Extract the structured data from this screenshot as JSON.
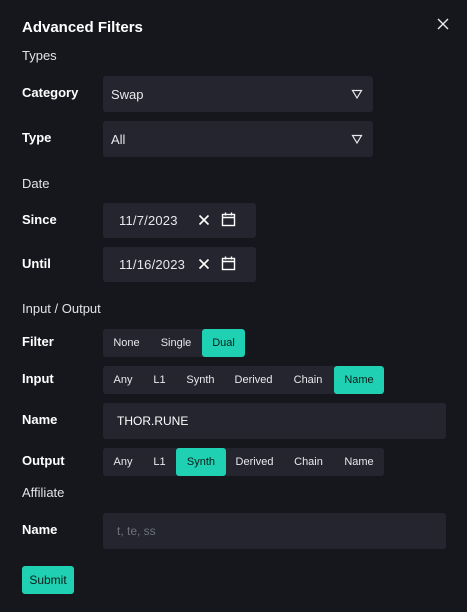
{
  "title": "Advanced Filters",
  "sections": {
    "types": "Types",
    "date": "Date",
    "io": "Input / Output",
    "affiliate": "Affiliate"
  },
  "category": {
    "label": "Category",
    "value": "Swap"
  },
  "type": {
    "label": "Type",
    "value": "All"
  },
  "since": {
    "label": "Since",
    "value": "11/7/2023"
  },
  "until": {
    "label": "Until",
    "value": "11/16/2023"
  },
  "filter": {
    "label": "Filter",
    "options": [
      "None",
      "Single",
      "Dual"
    ],
    "selected": "Dual"
  },
  "input": {
    "label": "Input",
    "options": [
      "Any",
      "L1",
      "Synth",
      "Derived",
      "Chain",
      "Name"
    ],
    "selected": "Name"
  },
  "input_name": {
    "label": "Name",
    "value": "THOR.RUNE"
  },
  "output": {
    "label": "Output",
    "options": [
      "Any",
      "L1",
      "Synth",
      "Derived",
      "Chain",
      "Name"
    ],
    "selected": "Synth"
  },
  "affiliate_name": {
    "label": "Name",
    "placeholder": "t, te, ss"
  },
  "submit_label": "Submit",
  "colors": {
    "accent": "#1fd1b2",
    "background": "#16171d",
    "field": "#24252e"
  }
}
